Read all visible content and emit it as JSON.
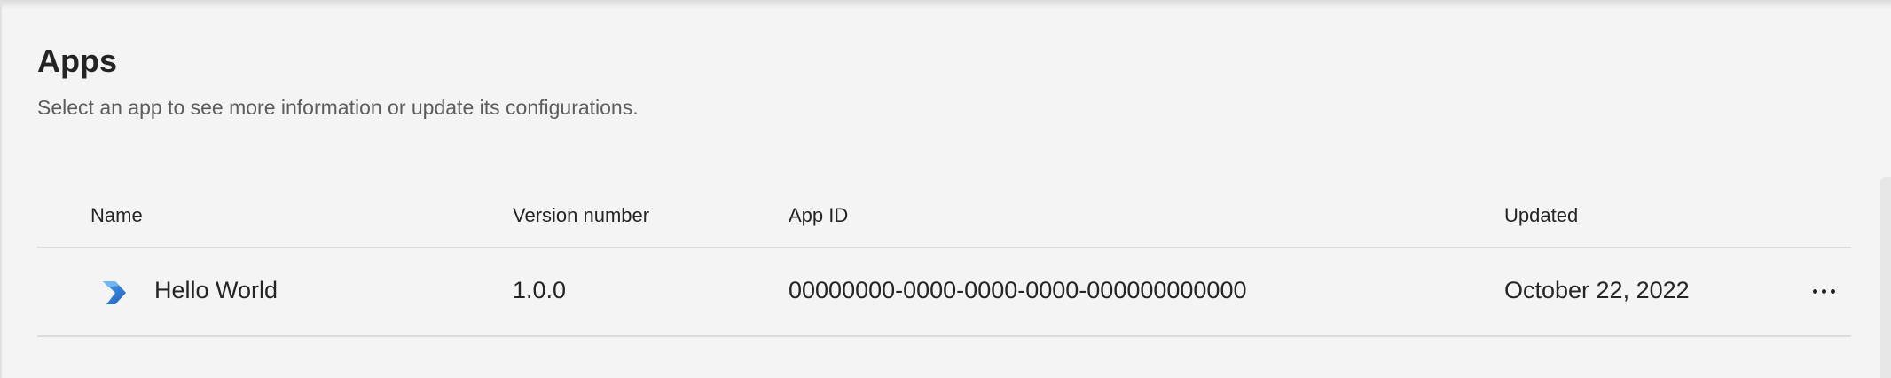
{
  "page": {
    "title": "Apps",
    "subtitle": "Select an app to see more information or update its configurations."
  },
  "table": {
    "columns": {
      "name": "Name",
      "version": "Version number",
      "app_id": "App ID",
      "updated": "Updated"
    },
    "rows": [
      {
        "icon": "power-apps-chevron-icon",
        "name": "Hello World",
        "version": "1.0.0",
        "app_id": "00000000-0000-0000-0000-000000000000",
        "updated": "October 22, 2022"
      }
    ]
  },
  "colors": {
    "background": "#f4f4f4",
    "text": "#242424",
    "muted_text": "#5c5c5c",
    "divider": "#dcdcdc",
    "icon_blue_dark": "#1f5fbf",
    "icon_blue_light": "#4a9fe8"
  }
}
